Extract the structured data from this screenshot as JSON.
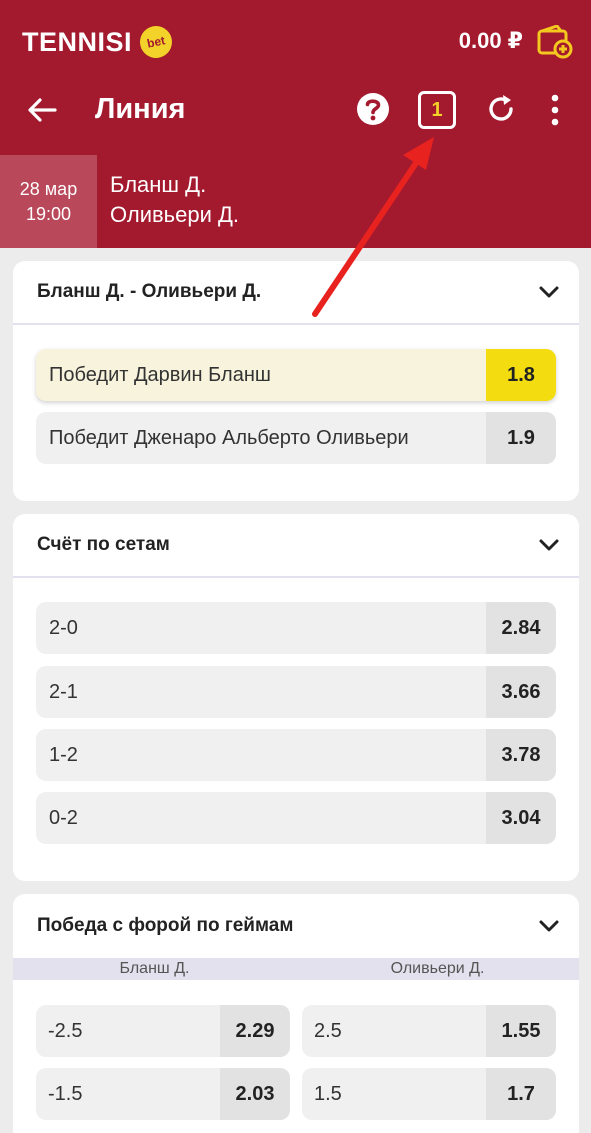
{
  "header": {
    "brand": "TENNISI",
    "brand_badge": "bet",
    "balance": "0.00 ₽",
    "title": "Линия",
    "coupon_count": "1"
  },
  "event": {
    "date": "28 мар",
    "time": "19:00",
    "player1": "Бланш Д.",
    "player2": "Оливьери Д."
  },
  "market_winner": {
    "title": "Бланш Д. - Оливьери Д.",
    "outcomes": [
      {
        "label": "Победит Дарвин Бланш",
        "odds": "1.8",
        "selected": true
      },
      {
        "label": "Победит Дженаро Альберто Оливьери",
        "odds": "1.9",
        "selected": false
      }
    ]
  },
  "market_sets": {
    "title": "Счёт по сетам",
    "outcomes": [
      {
        "label": "2-0",
        "odds": "2.84"
      },
      {
        "label": "2-1",
        "odds": "3.66"
      },
      {
        "label": "1-2",
        "odds": "3.78"
      },
      {
        "label": "0-2",
        "odds": "3.04"
      }
    ]
  },
  "market_handicap": {
    "title": "Победа с форой по геймам",
    "col_left": "Бланш Д.",
    "col_right": "Оливьери Д.",
    "rows": [
      {
        "left_label": "-2.5",
        "left_odds": "2.29",
        "right_label": "2.5",
        "right_odds": "1.55"
      },
      {
        "left_label": "-1.5",
        "left_odds": "2.03",
        "right_label": "1.5",
        "right_odds": "1.7"
      }
    ]
  },
  "colors": {
    "brand_red": "#a3192e",
    "selected_yellow": "#f3dc10",
    "annotation_arrow": "#e8221f"
  }
}
